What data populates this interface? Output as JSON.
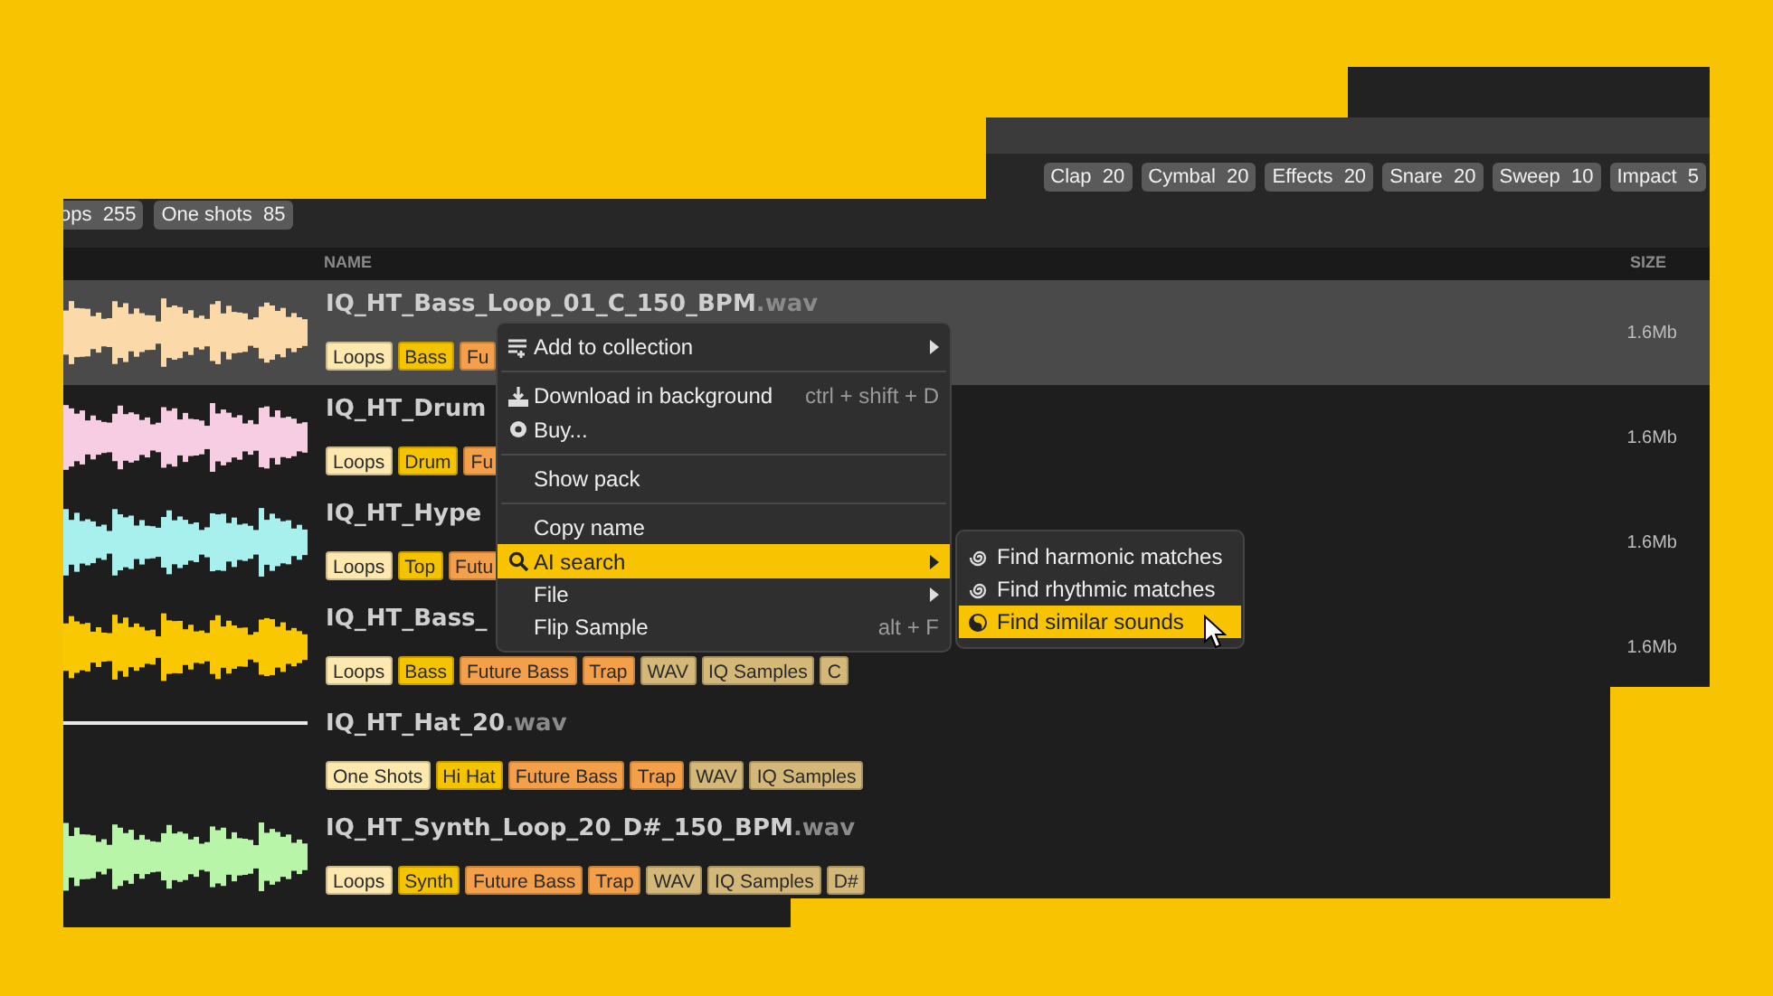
{
  "filter_chips": {
    "left": [
      {
        "label": "ops",
        "count": "255"
      },
      {
        "label": "One shots",
        "count": "85"
      }
    ],
    "right": [
      {
        "label": "Clap",
        "count": "20"
      },
      {
        "label": "Cymbal",
        "count": "20"
      },
      {
        "label": "Effects",
        "count": "20"
      },
      {
        "label": "Snare",
        "count": "20"
      },
      {
        "label": "Sweep",
        "count": "10"
      },
      {
        "label": "Impact",
        "count": "5"
      }
    ]
  },
  "table": {
    "columns": [
      "NAME",
      "SIZE"
    ],
    "rows": [
      {
        "selected": true,
        "name_parts": [
          {
            "kind": "stem",
            "text": "IQ_HT_Bass_Loop_01_C_150_BPM"
          },
          {
            "kind": "extension",
            "text": ".wav"
          }
        ],
        "size": "1.6Mb",
        "waveform": {
          "kind": "wave",
          "color": "#fcd9a8"
        },
        "tags": [
          {
            "label": "Loops",
            "color": "#fde9b0"
          },
          {
            "label": "Bass",
            "color": "#f5c400"
          },
          {
            "label": "Fu",
            "color": "#f4a04a"
          }
        ]
      },
      {
        "selected": false,
        "name_parts": [
          {
            "kind": "stem",
            "text": "IQ_HT_Drum"
          }
        ],
        "size": "1.6Mb",
        "waveform": {
          "kind": "wave",
          "color": "#f6cde3"
        },
        "tags": [
          {
            "label": "Loops",
            "color": "#fde9b0"
          },
          {
            "label": "Drum",
            "color": "#f5c400"
          },
          {
            "label": "Fu",
            "color": "#f4a04a"
          }
        ]
      },
      {
        "selected": false,
        "name_parts": [
          {
            "kind": "stem",
            "text": "IQ_HT_Hype"
          }
        ],
        "size": "1.6Mb",
        "waveform": {
          "kind": "wave",
          "color": "#a8f0ee"
        },
        "tags": [
          {
            "label": "Loops",
            "color": "#fde9b0"
          },
          {
            "label": "Top",
            "color": "#f5c400"
          },
          {
            "label": "Futu",
            "color": "#f4a04a"
          }
        ]
      },
      {
        "selected": false,
        "name_parts": [
          {
            "kind": "stem",
            "text": "IQ_HT_Bass_"
          }
        ],
        "size": "1.6Mb",
        "waveform": {
          "kind": "wave",
          "color": "#f9c800"
        },
        "tags": [
          {
            "label": "Loops",
            "color": "#fde9b0"
          },
          {
            "label": "Bass",
            "color": "#f5c400"
          },
          {
            "label": "Future Bass",
            "color": "#f4a04a"
          },
          {
            "label": "Trap",
            "color": "#f4a04a"
          },
          {
            "label": "WAV",
            "color": "#d4b87a"
          },
          {
            "label": "IQ Samples",
            "color": "#d4b87a"
          },
          {
            "label": "C",
            "color": "#d4b87a"
          }
        ]
      },
      {
        "selected": false,
        "name_parts": [
          {
            "kind": "stem",
            "text": "IQ_HT_Hat_20"
          },
          {
            "kind": "extension",
            "text": ".wav"
          }
        ],
        "waveform": {
          "kind": "flat",
          "color": "#e8e8e8"
        },
        "tags": [
          {
            "label": "One Shots",
            "color": "#fde9b0"
          },
          {
            "label": "Hi Hat",
            "color": "#f5c400"
          },
          {
            "label": "Future Bass",
            "color": "#f4a04a"
          },
          {
            "label": "Trap",
            "color": "#f4a04a"
          },
          {
            "label": "WAV",
            "color": "#d4b87a"
          },
          {
            "label": "IQ Samples",
            "color": "#d4b87a"
          }
        ]
      },
      {
        "selected": false,
        "name_parts": [
          {
            "kind": "stem",
            "text": "IQ_HT_Synth_Loop_20_D#_150_BPM"
          },
          {
            "kind": "extension",
            "text": ".wav"
          }
        ],
        "waveform": {
          "kind": "wave",
          "color": "#b8f5a8"
        },
        "tags": [
          {
            "label": "Loops",
            "color": "#fde9b0"
          },
          {
            "label": "Synth",
            "color": "#f5c400"
          },
          {
            "label": "Future Bass",
            "color": "#f4a04a"
          },
          {
            "label": "Trap",
            "color": "#f4a04a"
          },
          {
            "label": "WAV",
            "color": "#d4b87a"
          },
          {
            "label": "IQ Samples",
            "color": "#d4b87a"
          },
          {
            "label": "D#",
            "color": "#d4b87a"
          }
        ]
      }
    ]
  },
  "context_menu": {
    "items": [
      {
        "kind": "item",
        "label": "Add to collection",
        "has_submenu": true,
        "selected": false
      },
      {
        "kind": "separator"
      },
      {
        "kind": "item",
        "label": "Download in background",
        "shortcut": "ctrl + shift + D",
        "has_submenu": false,
        "selected": false
      },
      {
        "kind": "item",
        "label": "Buy...",
        "has_submenu": false,
        "selected": false
      },
      {
        "kind": "separator"
      },
      {
        "kind": "item",
        "label": "Show pack",
        "has_submenu": false,
        "selected": false
      },
      {
        "kind": "separator"
      },
      {
        "kind": "item",
        "label": "Copy name",
        "has_submenu": false,
        "selected": false
      },
      {
        "kind": "item",
        "label": "AI search",
        "has_submenu": true,
        "selected": true
      },
      {
        "kind": "item",
        "label": "File",
        "has_submenu": true,
        "selected": false
      },
      {
        "kind": "item",
        "label": "Flip Sample",
        "shortcut": "alt + F",
        "has_submenu": false,
        "selected": false
      }
    ]
  },
  "submenu": {
    "items": [
      {
        "label": "Find harmonic matches",
        "selected": false
      },
      {
        "label": "Find rhythmic matches",
        "selected": false
      },
      {
        "label": "Find similar sounds",
        "selected": true
      }
    ]
  }
}
